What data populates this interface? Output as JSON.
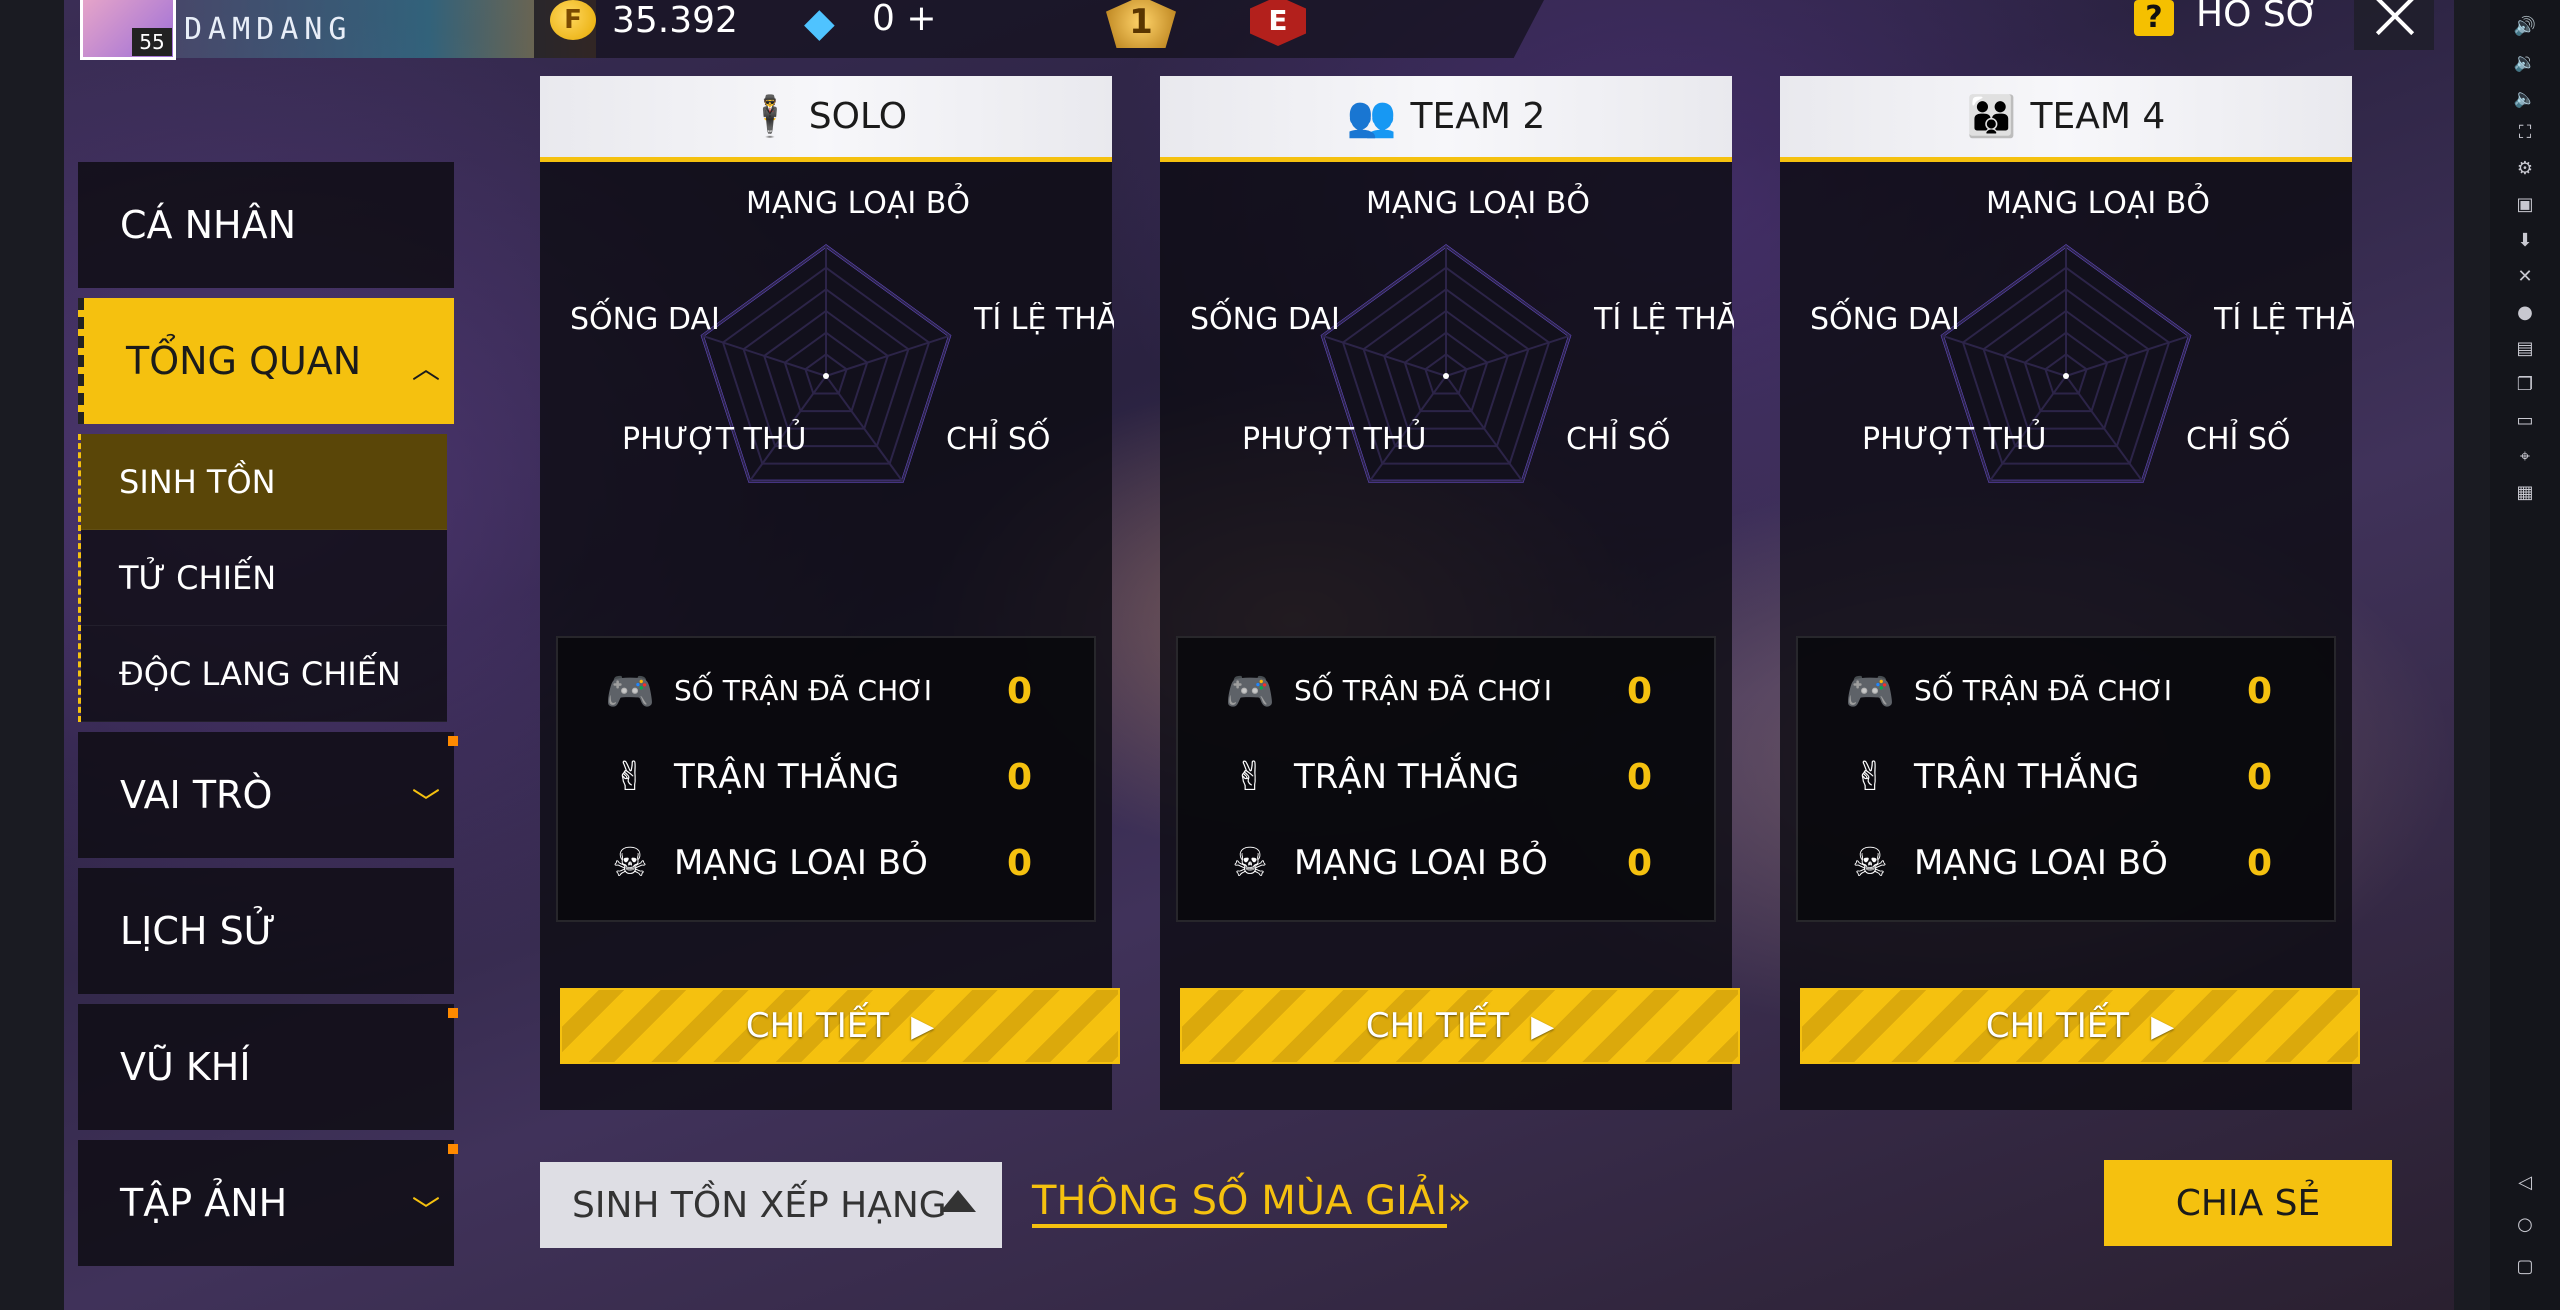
{
  "header": {
    "player_name": "DAMDANG",
    "level": "55",
    "coins": "35.392",
    "diamonds": "0",
    "diamonds_plus": "+",
    "rank_badge": "1",
    "elite_badge": "E",
    "help_icon": "?",
    "title": "HỒ SƠ"
  },
  "nav": {
    "items": [
      {
        "label": "CÁ NHÂN"
      },
      {
        "label": "TỔNG QUAN"
      },
      {
        "label": "VAI TRÒ"
      },
      {
        "label": "LỊCH SỬ"
      },
      {
        "label": "VŨ KHÍ"
      },
      {
        "label": "TẬP ẢNH"
      }
    ],
    "sub_items": [
      {
        "label": "SINH TỒN"
      },
      {
        "label": "TỬ CHIẾN"
      },
      {
        "label": "ĐỘC LANG CHIẾN"
      }
    ]
  },
  "cards": [
    {
      "mode": "SOLO",
      "radar_labels": {
        "top": "MẠNG LOẠI BỎ",
        "right": "TỈ LỆ THẮNG",
        "left": "SỐNG DAI",
        "bottom_left": "PHƯỢT THỦ",
        "bottom_right": "CHỈ SỐ"
      },
      "stats": [
        {
          "label": "SỐ TRẬN ĐÃ CHƠI",
          "value": "0",
          "icon": "gamepad-icon"
        },
        {
          "label": "TRẬN THẮNG",
          "value": "0",
          "icon": "victory-icon"
        },
        {
          "label": "MẠNG LOẠI BỎ",
          "value": "0",
          "icon": "skull-icon"
        }
      ],
      "button": "CHI TIẾT"
    },
    {
      "mode": "TEAM 2",
      "radar_labels": {
        "top": "MẠNG LOẠI BỎ",
        "right": "TỈ LỆ THẮNG",
        "left": "SỐNG DAI",
        "bottom_left": "PHƯỢT THỦ",
        "bottom_right": "CHỈ SỐ"
      },
      "stats": [
        {
          "label": "SỐ TRẬN ĐÃ CHƠI",
          "value": "0",
          "icon": "gamepad-icon"
        },
        {
          "label": "TRẬN THẮNG",
          "value": "0",
          "icon": "victory-icon"
        },
        {
          "label": "MẠNG LOẠI BỎ",
          "value": "0",
          "icon": "skull-icon"
        }
      ],
      "button": "CHI TIẾT"
    },
    {
      "mode": "TEAM 4",
      "radar_labels": {
        "top": "MẠNG LOẠI BỎ",
        "right": "TỈ LỆ THẮNG",
        "left": "SỐNG DAI",
        "bottom_left": "PHƯỢT THỦ",
        "bottom_right": "CHỈ SỐ"
      },
      "stats": [
        {
          "label": "SỐ TRẬN ĐÃ CHƠI",
          "value": "0",
          "icon": "gamepad-icon"
        },
        {
          "label": "TRẬN THẮNG",
          "value": "0",
          "icon": "victory-icon"
        },
        {
          "label": "MẠNG LOẠI BỎ",
          "value": "0",
          "icon": "skull-icon"
        }
      ],
      "button": "CHI TIẾT"
    }
  ],
  "footer": {
    "mode_select": "SINH TỒN XẾP HẠNG",
    "season_link": "THÔNG SỐ MÙA GIẢI",
    "season_arrows": "»",
    "share": "CHIA SẺ"
  },
  "colors": {
    "accent": "#f5c10f",
    "panel": "#0e0c14",
    "header_light": "#f0f0f4",
    "radar_line": "#6a4fd0"
  }
}
